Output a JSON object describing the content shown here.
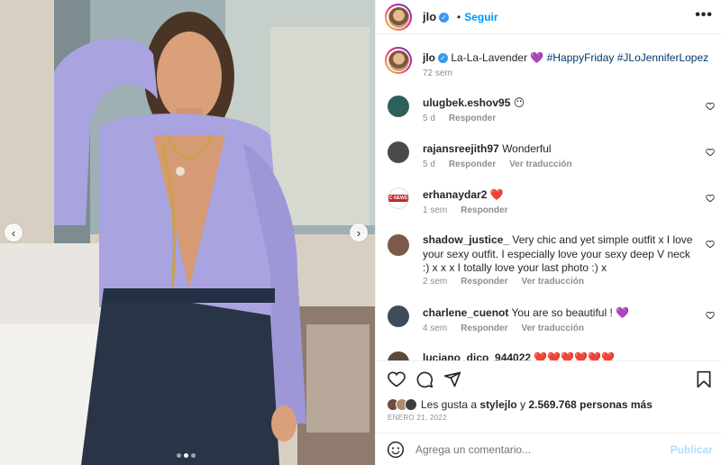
{
  "post": {
    "username": "jlo",
    "follow_label": "Seguir",
    "separator": "•",
    "more_label": "•••",
    "caption_text": "La-La-Lavender 💜",
    "caption_hashtags": "#HappyFriday #JLoJenniferLopez",
    "caption_time": "72 sem"
  },
  "media": {
    "prev_label": "‹",
    "next_label": "›",
    "dots": [
      {
        "active": false
      },
      {
        "active": true
      },
      {
        "active": false
      }
    ],
    "colors": {
      "top": "#8fa0a6",
      "blouse": "#a9a3e0",
      "jeans": "#2a3447",
      "wall": "#d8cfc3"
    }
  },
  "comments": [
    {
      "username": "ulugbek.eshov95",
      "text": "😶",
      "time": "5 d",
      "reply": "Responder",
      "translate": "",
      "avatar_color": "#2f5f5b"
    },
    {
      "username": "rajansreejith97",
      "text": "Wonderful",
      "time": "5 d",
      "reply": "Responder",
      "translate": "Ver traducción",
      "avatar_color": "#4a4a4a"
    },
    {
      "username": "erhanaydar2",
      "text": "❤️",
      "time": "1 sem",
      "reply": "Responder",
      "translate": "",
      "avatar_color": "#c62828",
      "avatar_text": "C NEWS"
    },
    {
      "username": "shadow_justice_",
      "text": "Very chic and yet simple outfit x I love your sexy outfit. I especially love your sexy deep V neck :) x x x I totally love your last photo :) x",
      "time": "2 sem",
      "reply": "Responder",
      "translate": "Ver traducción",
      "avatar_color": "#7b5a4a"
    },
    {
      "username": "charlene_cuenot",
      "text": "You are so beautiful ! 💜",
      "time": "4 sem",
      "reply": "Responder",
      "translate": "Ver traducción",
      "avatar_color": "#3f4a5a"
    },
    {
      "username": "luciano_dico_944022",
      "text": "❤️❤️❤️❤️❤️❤️",
      "time": "",
      "reply": "",
      "translate": "",
      "avatar_color": "#5a4a3a"
    }
  ],
  "likes": {
    "prefix": "Les gusta a",
    "user": "stylejlo",
    "conj": "y",
    "count": "2.569.768 personas más",
    "avatar_colors": [
      "#6b4e3d",
      "#b08a6a",
      "#3d3d3d"
    ]
  },
  "date_label": "ENERO 21, 2022",
  "composer": {
    "placeholder": "Agrega un comentario...",
    "publish_label": "Publicar"
  },
  "icons": {
    "verified": "verified-badge-icon",
    "heart": "heart-icon",
    "comment": "comment-icon",
    "share": "share-icon",
    "save": "bookmark-icon",
    "emoji": "emoji-icon",
    "more": "more-options-icon"
  },
  "colors": {
    "link": "#0095f6",
    "hashtag": "#00376b",
    "muted": "#8e8e8e",
    "publish_disabled": "#b2dffc"
  }
}
